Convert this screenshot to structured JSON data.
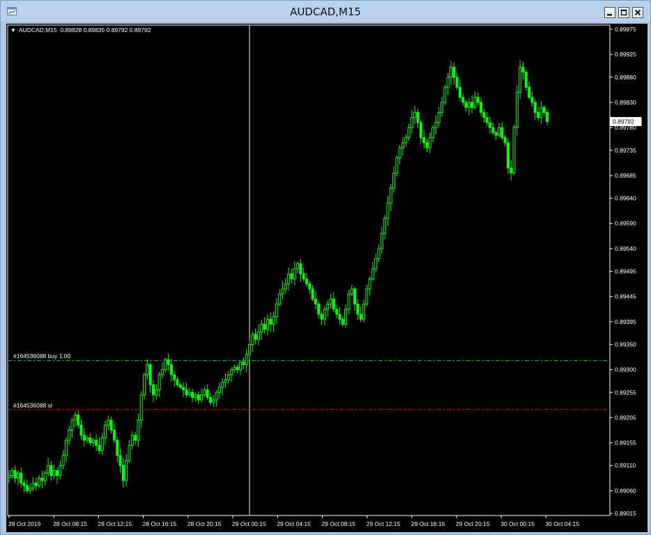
{
  "window": {
    "title": "AUDCAD,M15",
    "icon": "chart-window-icon",
    "buttons": {
      "minimize": "minimize-icon",
      "restore": "restore-icon",
      "close": "close-icon"
    }
  },
  "chart_info": {
    "symbol": "AUDCAD,M15",
    "ohlc": "0.89828 0.89835 0.89792 0.89792"
  },
  "orders": [
    {
      "label": "#164536088 buy 1.00",
      "price": 0.89318,
      "color": "#33bb33",
      "style": "dash-dot"
    },
    {
      "label": "#164536088 sl",
      "price": 0.89221,
      "color": "#ee1111",
      "style": "dash-dot"
    }
  ],
  "current_price": "0.89792",
  "colors": {
    "background": "#000000",
    "candles": "#00ff00",
    "axes": "#ffffff",
    "crosshair": "#ffff66"
  },
  "chart_data": {
    "type": "candlestick",
    "symbol": "AUDCAD",
    "timeframe": "M15",
    "y_ticks": [
      "0.89975",
      "0.89925",
      "0.89880",
      "0.89830",
      "0.89780",
      "0.89735",
      "0.89685",
      "0.89640",
      "0.89590",
      "0.89540",
      "0.89495",
      "0.89445",
      "0.89395",
      "0.89350",
      "0.89300",
      "0.89255",
      "0.89205",
      "0.89155",
      "0.89110",
      "0.89060",
      "0.89015"
    ],
    "x_ticks": [
      "28 Oct 2019",
      "28 Oct 08:15",
      "28 Oct 12:15",
      "28 Oct 16:15",
      "28 Oct 20:15",
      "29 Oct 00:15",
      "29 Oct 04:15",
      "29 Oct 08:15",
      "29 Oct 12:15",
      "29 Oct 16:15",
      "29 Oct 20:15",
      "30 Oct 00:15",
      "30 Oct 04:15"
    ],
    "ylim": [
      0.89015,
      0.89975
    ],
    "vertical_marker": "29 Oct 00:15",
    "closes": [
      0.8909,
      0.891,
      0.89085,
      0.89095,
      0.89075,
      0.8907,
      0.8906,
      0.89065,
      0.89075,
      0.8907,
      0.89085,
      0.8908,
      0.89095,
      0.8911,
      0.8909,
      0.891,
      0.8909,
      0.8911,
      0.8913,
      0.8916,
      0.8918,
      0.892,
      0.8921,
      0.8919,
      0.8917,
      0.8916,
      0.89165,
      0.89155,
      0.8916,
      0.8915,
      0.8914,
      0.89165,
      0.8919,
      0.892,
      0.8918,
      0.8916,
      0.8913,
      0.8911,
      0.8908,
      0.8912,
      0.8915,
      0.8917,
      0.8916,
      0.892,
      0.8925,
      0.8929,
      0.8931,
      0.8927,
      0.8925,
      0.8926,
      0.8929,
      0.893,
      0.8932,
      0.8931,
      0.8929,
      0.8928,
      0.8927,
      0.89265,
      0.8926,
      0.8925,
      0.89255,
      0.89245,
      0.8925,
      0.8924,
      0.8925,
      0.8926,
      0.89245,
      0.89235,
      0.8924,
      0.89255,
      0.89265,
      0.89275,
      0.8928,
      0.8929,
      0.893,
      0.89305,
      0.893,
      0.89315,
      0.8931,
      0.8933,
      0.8935,
      0.8937,
      0.8936,
      0.89375,
      0.8939,
      0.8938,
      0.894,
      0.8939,
      0.89405,
      0.8943,
      0.8945,
      0.8946,
      0.8947,
      0.8949,
      0.8948,
      0.895,
      0.8951,
      0.8949,
      0.8948,
      0.8947,
      0.8946,
      0.8944,
      0.8943,
      0.8941,
      0.894,
      0.8942,
      0.8943,
      0.8944,
      0.8942,
      0.8941,
      0.894,
      0.8939,
      0.8942,
      0.8945,
      0.8946,
      0.8943,
      0.8941,
      0.894,
      0.8943,
      0.8946,
      0.8948,
      0.895,
      0.8952,
      0.8954,
      0.8957,
      0.896,
      0.8963,
      0.8966,
      0.8969,
      0.8972,
      0.8974,
      0.8975,
      0.8976,
      0.8978,
      0.898,
      0.8981,
      0.8979,
      0.8976,
      0.8975,
      0.8974,
      0.8976,
      0.8978,
      0.8979,
      0.8981,
      0.8983,
      0.8986,
      0.8988,
      0.899,
      0.8988,
      0.8986,
      0.8984,
      0.8983,
      0.8982,
      0.8983,
      0.8982,
      0.8984,
      0.8983,
      0.8981,
      0.898,
      0.8979,
      0.8978,
      0.8977,
      0.89765,
      0.8978,
      0.8976,
      0.8975,
      0.897,
      0.8969,
      0.8978,
      0.8985,
      0.899,
      0.8989,
      0.8986,
      0.8984,
      0.8983,
      0.8981,
      0.898,
      0.8982,
      0.8981,
      0.89792
    ]
  }
}
